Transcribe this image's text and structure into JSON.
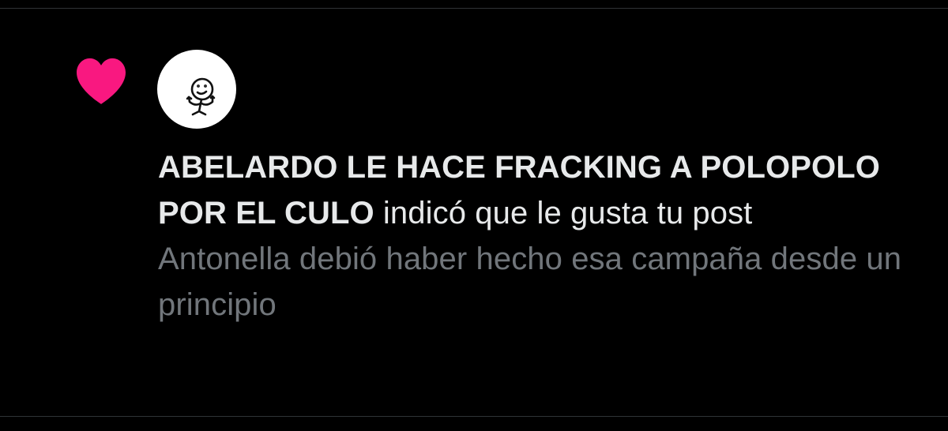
{
  "notification": {
    "type_icon": "heart-icon",
    "type_icon_color": "#f91880",
    "avatar": "stick-figure-avatar",
    "user_name": "ABELARDO LE HACE FRACKING A POLOPOLO POR EL CULO",
    "action_text": " indicó que le gusta tu post",
    "post_preview": "Antonella debió haber hecho esa campaña desde un principio"
  },
  "colors": {
    "background": "#000000",
    "primary_text": "#e7e9ea",
    "secondary_text": "#71767b",
    "divider": "#2f3336",
    "like_accent": "#f91880"
  }
}
